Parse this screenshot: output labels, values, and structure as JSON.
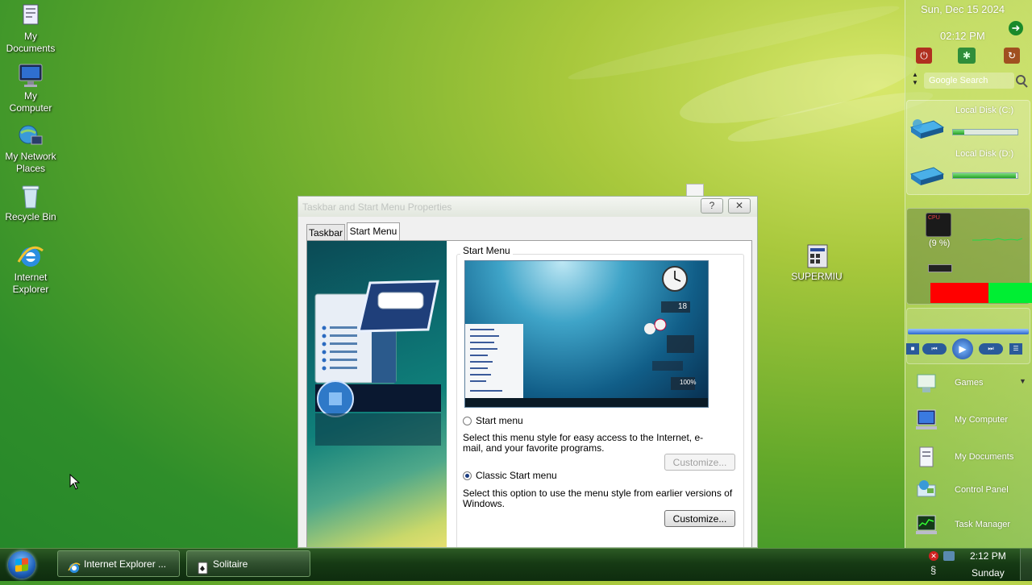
{
  "desktop": {
    "icons": [
      {
        "label_line1": "My",
        "label_line2": "Documents"
      },
      {
        "label_line1": "My",
        "label_line2": "Computer"
      },
      {
        "label_line1": "My Network",
        "label_line2": "Places"
      },
      {
        "label_line1": "Recycle Bin",
        "label_line2": ""
      },
      {
        "label_line1": "Internet",
        "label_line2": "Explorer"
      }
    ],
    "supermiu_label": "SUPERMIU"
  },
  "dialog": {
    "title": "Taskbar and Start Menu Properties",
    "help_button": "?",
    "close_button": "✕",
    "tabs": [
      {
        "label": "Taskbar"
      },
      {
        "label": "Start Menu"
      }
    ],
    "active_tab": "Start Menu",
    "group_label": "Start Menu",
    "preview_clock_value": "18",
    "preview_meter_value": "100%",
    "option_start": {
      "label": "Start menu",
      "description": "Select this menu style for easy access to the Internet, e-mail, and your favorite programs.",
      "customize_label": "Customize...",
      "selected": false,
      "customize_enabled": false
    },
    "option_classic": {
      "label": "Classic Start menu",
      "description": "Select this option to use the menu style from earlier versions of Windows.",
      "customize_label": "Customize...",
      "selected": true,
      "customize_enabled": true
    }
  },
  "taskbar": {
    "tasks": [
      {
        "label": "Internet Explorer ...",
        "icon": "ie-icon"
      },
      {
        "label": "Solitaire",
        "icon": "solitaire-icon"
      }
    ],
    "clock_time": "2:12 PM",
    "clock_day": "Sunday"
  },
  "sidebar": {
    "date": "Sun, Dec 15 2024",
    "time": "02:12 PM",
    "search_placeholder": "Google Search",
    "disks": [
      {
        "label": "Local Disk (C:)",
        "used_fraction": 0.18
      },
      {
        "label": "Local Disk (D:)",
        "used_fraction": 0.98
      }
    ],
    "cpu_label": "CPU",
    "cpu_percent": "(9 %)",
    "memory_used_fraction": 0.57,
    "launchers": [
      {
        "label": "Games"
      },
      {
        "label": "My Computer"
      },
      {
        "label": "My Documents"
      },
      {
        "label": "Control Panel"
      },
      {
        "label": "Task Manager"
      }
    ]
  },
  "colors": {
    "memory_used": "#ff0000",
    "memory_free": "#00ee33",
    "desktop_green": "#2f8e2a"
  }
}
